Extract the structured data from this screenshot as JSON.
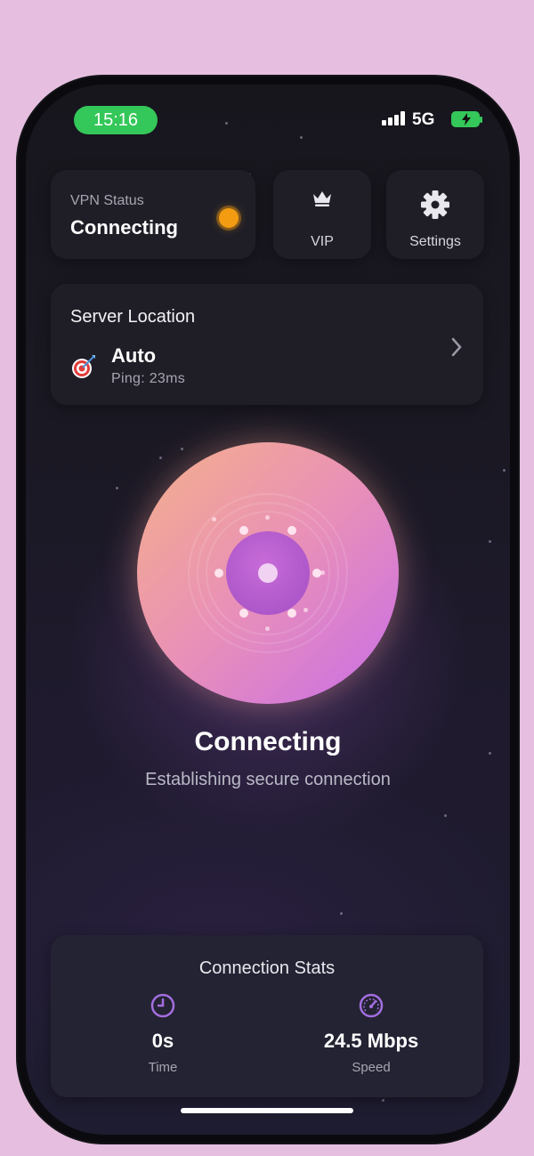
{
  "status_bar": {
    "time": "15:16",
    "network": "5G"
  },
  "vpn_status": {
    "label": "VPN Status",
    "value": "Connecting",
    "status_color": "#f39c12"
  },
  "tiles": {
    "vip_label": "VIP",
    "vip_icon": "crown-icon",
    "settings_label": "Settings",
    "settings_icon": "gear-icon"
  },
  "server": {
    "title": "Server Location",
    "name": "Auto",
    "ping": "Ping: 23ms",
    "icon": "target-icon"
  },
  "connection": {
    "title": "Connecting",
    "subtitle": "Establishing secure connection"
  },
  "stats": {
    "title": "Connection Stats",
    "time_value": "0s",
    "time_label": "Time",
    "time_icon": "clock-icon",
    "speed_value": "24.5 Mbps",
    "speed_label": "Speed",
    "speed_icon": "speedometer-icon"
  },
  "colors": {
    "accent": "#9b59d6",
    "connected_green": "#34c759",
    "background": "#1c1a26"
  }
}
